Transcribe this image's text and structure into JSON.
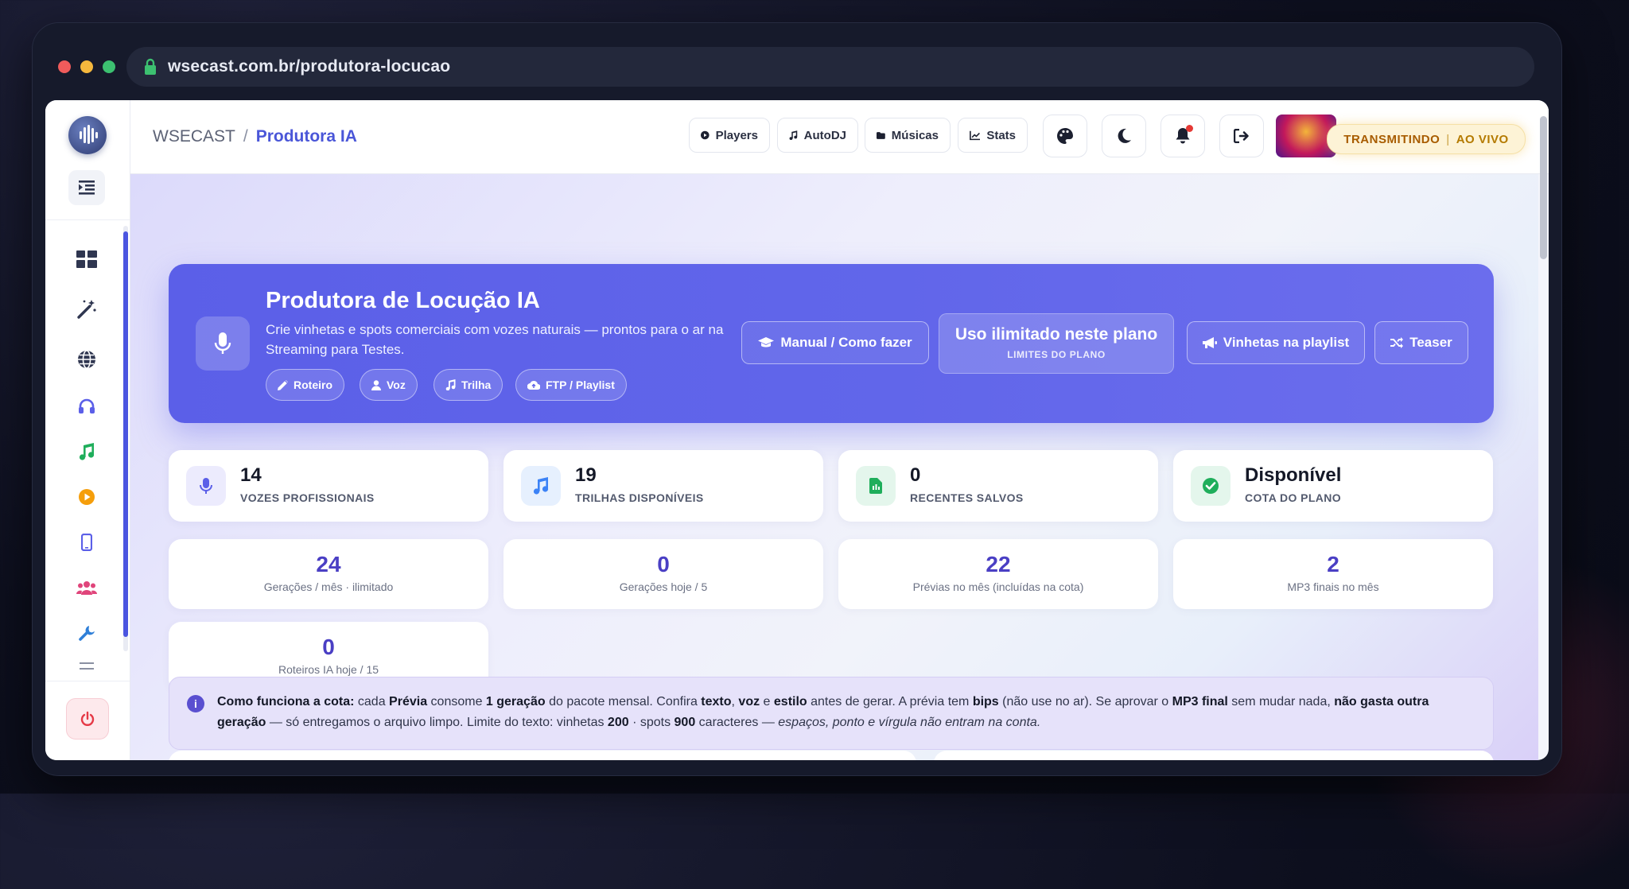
{
  "browser": {
    "url": "wsecast.com.br/produtora-locucao",
    "dots": [
      "#ef5b5b",
      "#f5b83d",
      "#3cc070"
    ]
  },
  "sidebar": {
    "logo_text": "WSECAST",
    "icons": [
      {
        "name": "dashboard-icon",
        "color": "#2f3650"
      },
      {
        "name": "magic-wand-icon",
        "color": "#2f3650"
      },
      {
        "name": "globe-icon",
        "color": "#2f3650"
      },
      {
        "name": "headphones-icon",
        "color": "#5b5fe8"
      },
      {
        "name": "music-note-icon",
        "color": "#1fae5b"
      },
      {
        "name": "play-circle-icon",
        "color": "#f59e0b"
      },
      {
        "name": "mobile-icon",
        "color": "#5b5fe8"
      },
      {
        "name": "users-icon",
        "color": "#e0457b"
      },
      {
        "name": "wrench-icon",
        "color": "#2f7fd8"
      },
      {
        "name": "sliders-icon",
        "color": "#8a90a2"
      }
    ]
  },
  "header": {
    "breadcrumb_root": "WSECAST",
    "breadcrumb_sep": "/",
    "breadcrumb_current": "Produtora IA",
    "nav": {
      "players": "Players",
      "autodj": "AutoDJ",
      "musicas": "Músicas",
      "stats": "Stats"
    },
    "status_main": "TRANSMITINDO",
    "status_sep": "|",
    "status_sub": "AO VIVO"
  },
  "hero": {
    "title": "Produtora de Locução IA",
    "subtitle": "Crie vinhetas e spots comerciais com vozes naturais — prontos para o ar na Streaming para Testes.",
    "chips": {
      "roteiro": "Roteiro",
      "voz": "Voz",
      "trilha": "Trilha",
      "ftp": "FTP / Playlist"
    },
    "manual_btn": "Manual / Como fazer",
    "quota_big": "Uso ilimitado neste plano",
    "quota_small": "LIMITES DO PLANO",
    "playlist_btn": "Vinhetas na playlist",
    "teaser_btn": "Teaser"
  },
  "stats": [
    {
      "value": "14",
      "label": "VOZES PROFISSIONAIS",
      "color": "#5b5fe8",
      "bg": "#ecebfd"
    },
    {
      "value": "19",
      "label": "TRILHAS DISPONÍVEIS",
      "color": "#3b82f6",
      "bg": "#e6f0fe"
    },
    {
      "value": "0",
      "label": "RECENTES SALVOS",
      "color": "#1fae5b",
      "bg": "#e4f6ec"
    },
    {
      "value": "Disponível",
      "label": "COTA DO PLANO",
      "color": "#1fae5b",
      "bg": "#e4f6ec"
    }
  ],
  "mini": [
    {
      "value": "24",
      "label": "Gerações / mês · ilimitado"
    },
    {
      "value": "0",
      "label": "Gerações hoje / 5"
    },
    {
      "value": "22",
      "label": "Prévias no mês (incluídas na cota)"
    },
    {
      "value": "2",
      "label": "MP3 finais no mês"
    },
    {
      "value": "0",
      "label": "Roteiros IA hoje / 15"
    }
  ],
  "info": {
    "lead": "Como funciona a cota:",
    "t1": " cada ",
    "b1": "Prévia",
    "t2": " consome ",
    "b2": "1 geração",
    "t3": " do pacote mensal. Confira ",
    "b3": "texto",
    "t4": ", ",
    "b4": "voz",
    "t5": " e ",
    "b5": "estilo",
    "t6": " antes de gerar. A prévia tem ",
    "b6": "bips",
    "t7": " (não use no ar). Se aprovar o ",
    "b7": "MP3 final",
    "t8": " sem mudar nada, ",
    "b8": "não gasta outra geração",
    "t9": " — só entregamos o arquivo limpo. Limite do texto: vinhetas ",
    "b9": "200",
    "t10": " · spots ",
    "b10": "900",
    "t11": " caracteres — ",
    "i1": "espaços, ponto e vírgula não entram na conta."
  }
}
